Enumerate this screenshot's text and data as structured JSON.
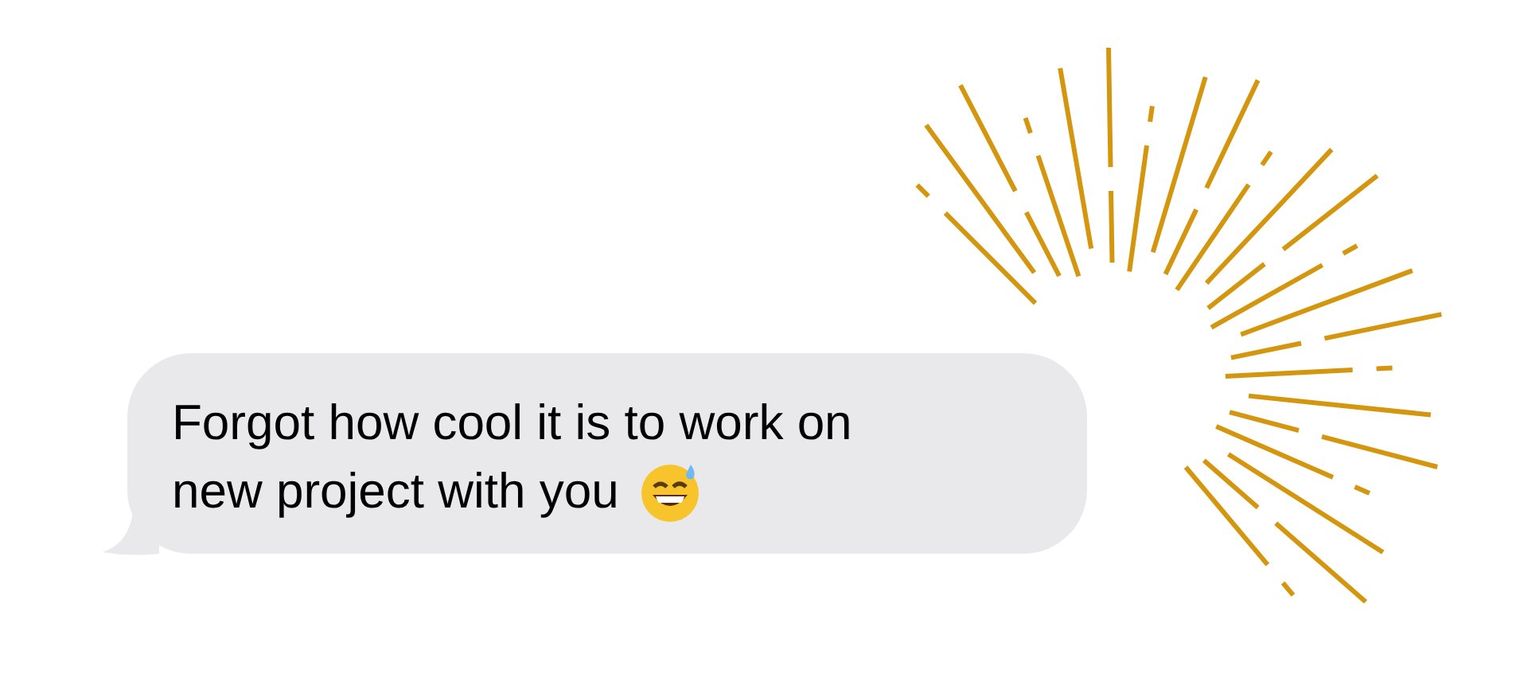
{
  "message": {
    "lines": [
      "Forgot how cool it is to work on",
      "new project with you"
    ],
    "emoji": true
  }
}
